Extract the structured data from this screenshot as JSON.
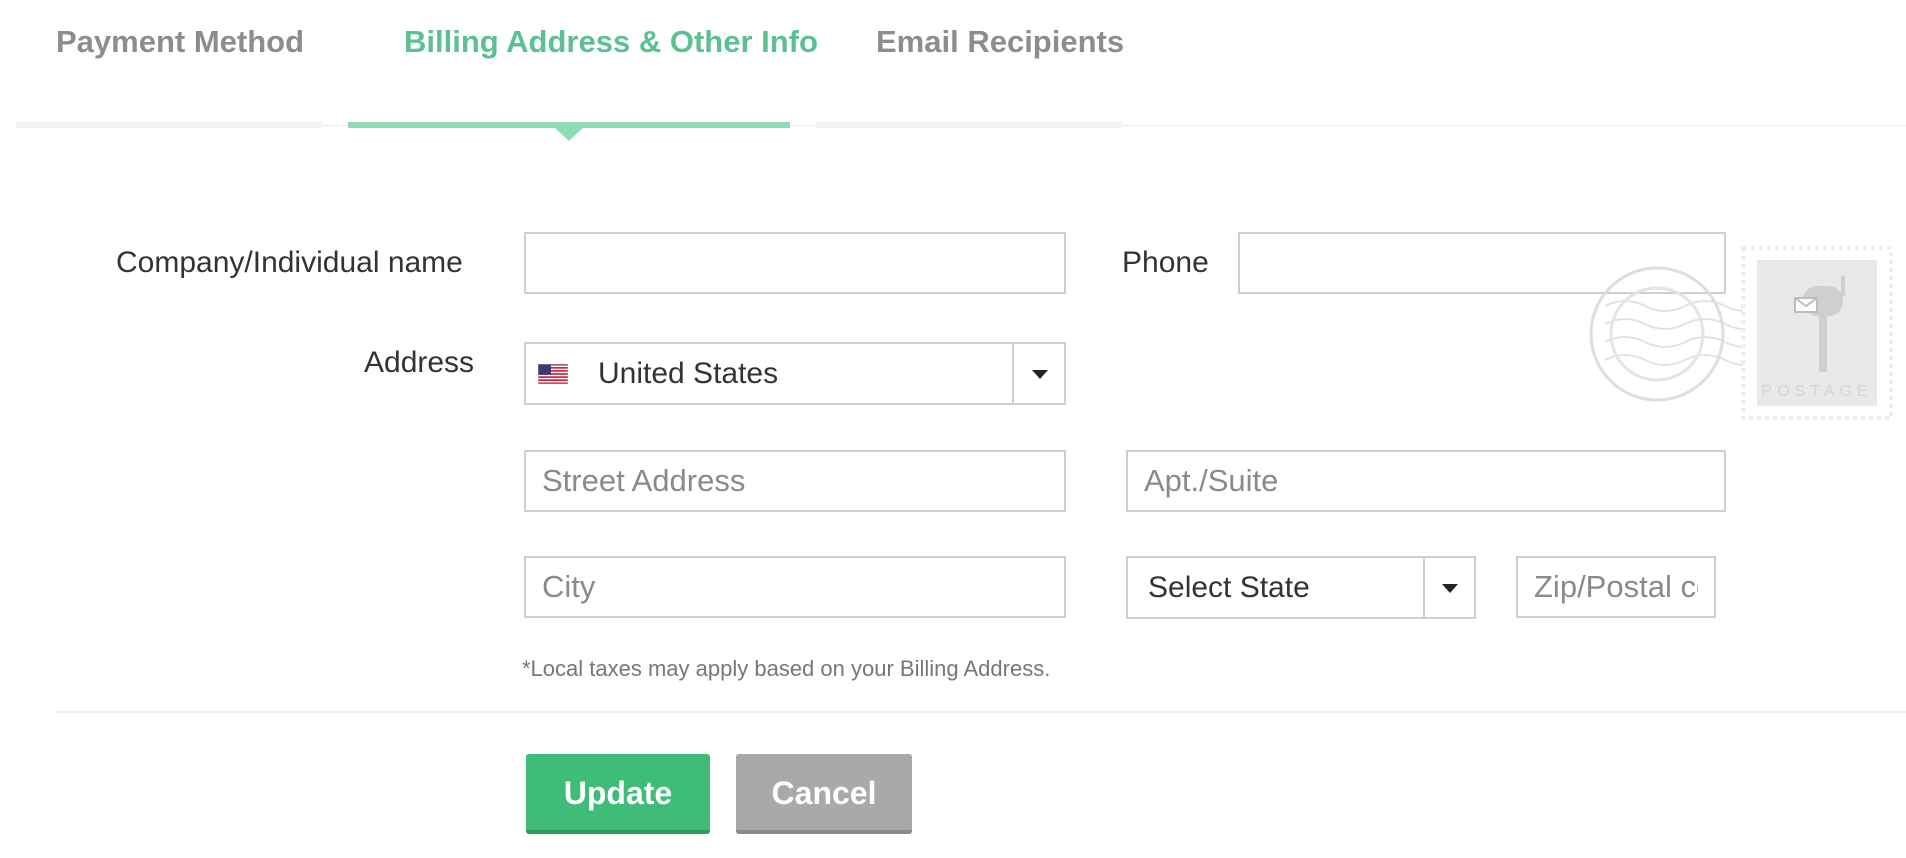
{
  "tabs": [
    {
      "label": "Payment Method",
      "active": false
    },
    {
      "label": "Billing Address & Other Info",
      "active": true
    },
    {
      "label": "Email Recipients",
      "active": false
    }
  ],
  "form": {
    "company_label": "Company/Individual name",
    "company_value": "",
    "phone_label": "Phone",
    "phone_value": "",
    "address_label": "Address",
    "country": {
      "selected": "United States",
      "flag_icon": "us-flag-icon"
    },
    "street_placeholder": "Street Address",
    "apt_placeholder": "Apt./Suite",
    "city_placeholder": "City",
    "state": {
      "selected": "Select State"
    },
    "zip_placeholder": "Zip/Postal code",
    "tax_note": "*Local taxes may apply based on your Billing Address."
  },
  "stamp": {
    "text": "POSTAGE",
    "icon": "mailbox-icon"
  },
  "actions": {
    "update_label": "Update",
    "cancel_label": "Cancel"
  },
  "colors": {
    "accent": "#5cc190",
    "active_tab_bar": "#8fdbb4",
    "update_button": "#3fbc77",
    "cancel_button": "#a9a9a9"
  }
}
